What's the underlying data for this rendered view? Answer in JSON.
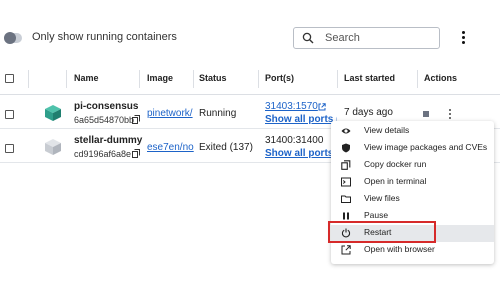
{
  "toolbar": {
    "toggle_label": "Only show running containers",
    "search_placeholder": "Search"
  },
  "table": {
    "headers": {
      "name": "Name",
      "image": "Image",
      "status": "Status",
      "ports": "Port(s)",
      "last_started": "Last started",
      "actions": "Actions"
    },
    "rows": [
      {
        "name": "pi-consensus",
        "id": "6a65d54870bb",
        "image": "pinetwork/",
        "status": "Running",
        "port": "31403:1570",
        "all_ports": "Show all ports (3)",
        "last_started": "7 days ago",
        "icon_color": "#2e9e8a"
      },
      {
        "name": "stellar-dummy",
        "id": "cd9196af6a8e",
        "image": "ese7en/no",
        "status": "Exited (137)",
        "port": "31400:31400",
        "all_ports": "Show all ports (3)",
        "last_started": "",
        "icon_color": "#c8ccd2"
      }
    ]
  },
  "context_menu": {
    "items": [
      {
        "label": "View details",
        "icon": "eye-icon"
      },
      {
        "label": "View image packages and CVEs",
        "icon": "shield-icon"
      },
      {
        "label": "Copy docker run",
        "icon": "copy-icon"
      },
      {
        "label": "Open in terminal",
        "icon": "terminal-icon"
      },
      {
        "label": "View files",
        "icon": "folder-icon"
      },
      {
        "label": "Pause",
        "icon": "pause-icon"
      },
      {
        "label": "Restart",
        "icon": "restart-icon"
      },
      {
        "label": "Open with browser",
        "icon": "open-external-icon"
      }
    ],
    "highlighted": "Restart"
  },
  "colors": {
    "link": "#1d63c8",
    "highlight_border": "#d62a2a"
  }
}
